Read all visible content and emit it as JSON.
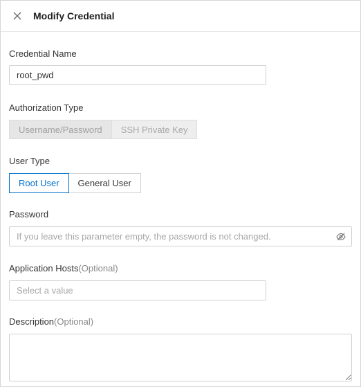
{
  "header": {
    "title": "Modify Credential",
    "close_icon": "close-icon"
  },
  "credential_name": {
    "label": "Credential Name",
    "value": "root_pwd"
  },
  "authorization_type": {
    "label": "Authorization Type",
    "options": [
      "Username/Password",
      "SSH Private Key"
    ],
    "selected": "Username/Password",
    "disabled": true
  },
  "user_type": {
    "label": "User Type",
    "options": [
      "Root User",
      "General User"
    ],
    "selected": "Root User",
    "accent_color": "#0070cc"
  },
  "password": {
    "label": "Password",
    "placeholder": "If you leave this parameter empty, the password is not changed.",
    "toggle_icon": "eye-slash-icon"
  },
  "application_hosts": {
    "label": "Application Hosts",
    "optional": "(Optional)",
    "placeholder": "Select a value"
  },
  "description": {
    "label": "Description",
    "optional": "(Optional)",
    "value": ""
  }
}
